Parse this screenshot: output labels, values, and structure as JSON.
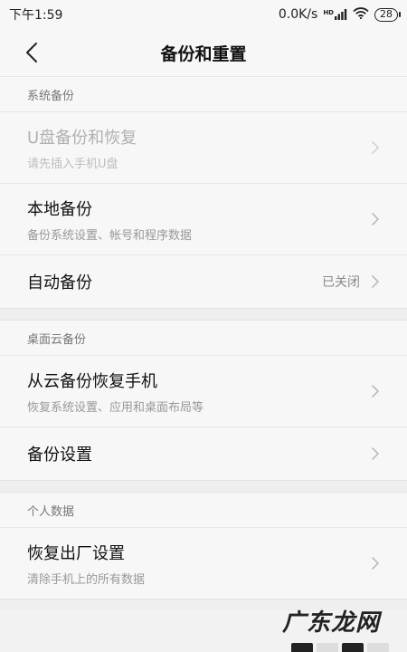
{
  "status_bar": {
    "time": "下午1:59",
    "network_speed": "0.0K/s",
    "signal_label": "HD",
    "battery": "28"
  },
  "app_bar": {
    "title": "备份和重置"
  },
  "sections": [
    {
      "header": "系统备份",
      "items": [
        {
          "title": "U盘备份和恢复",
          "subtitle": "请先插入手机U盘",
          "disabled": true
        },
        {
          "title": "本地备份",
          "subtitle": "备份系统设置、帐号和程序数据"
        },
        {
          "title": "自动备份",
          "value": "已关闭"
        }
      ]
    },
    {
      "header": "桌面云备份",
      "items": [
        {
          "title": "从云备份恢复手机",
          "subtitle": "恢复系统设置、应用和桌面布局等"
        },
        {
          "title": "备份设置"
        }
      ]
    },
    {
      "header": "个人数据",
      "items": [
        {
          "title": "恢复出厂设置",
          "subtitle": "清除手机上的所有数据"
        }
      ]
    }
  ],
  "watermark": "广东龙网",
  "icons": {
    "back": "chevron-left-icon",
    "row_arrow": "chevron-right-icon",
    "wifi": "wifi-icon",
    "signal": "signal-icon",
    "battery": "battery-icon"
  },
  "colors": {
    "background": "#f2f2f2",
    "surface": "#f7f7f7",
    "primary_text": "#111111",
    "secondary_text": "#999999",
    "disabled_text": "#b0b0b0"
  }
}
